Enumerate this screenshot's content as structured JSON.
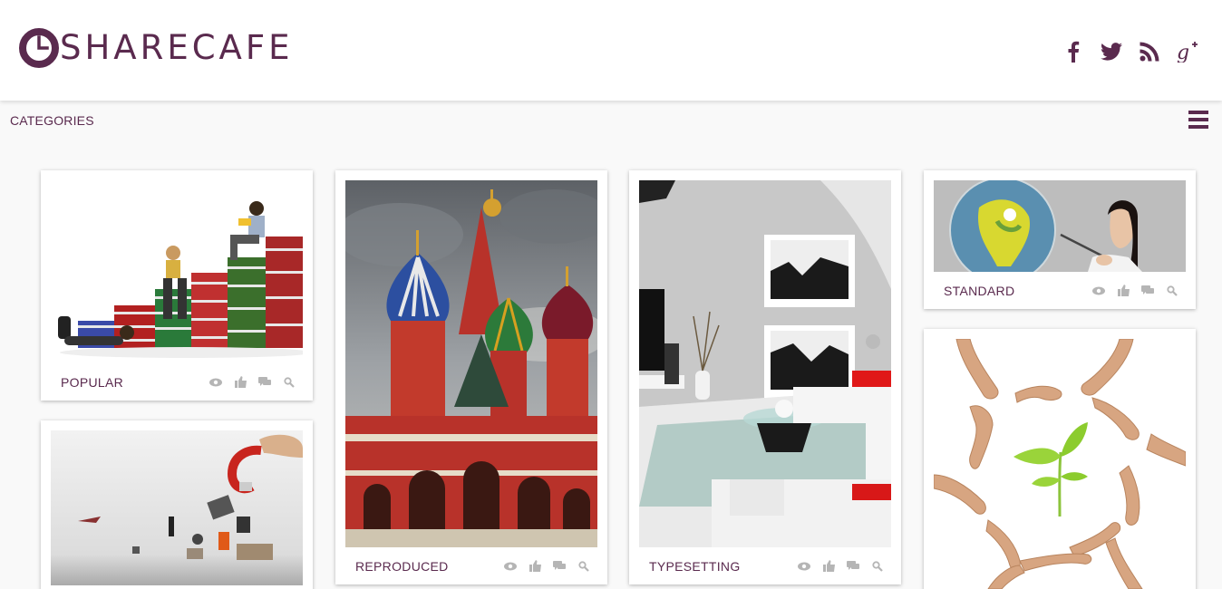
{
  "brand": {
    "name": "SHARECAFE",
    "color": "#5a2a4e"
  },
  "social": [
    {
      "name": "facebook-icon",
      "glyph": "f"
    },
    {
      "name": "twitter-icon",
      "glyph": ""
    },
    {
      "name": "rss-icon",
      "glyph": ""
    },
    {
      "name": "google-plus-icon",
      "glyph": "g+"
    }
  ],
  "nav": {
    "categories_label": "CATEGORIES"
  },
  "cards": [
    {
      "title": "POPULAR",
      "image": "students-on-books"
    },
    {
      "title": "REPRODUCED",
      "image": "st-basils-cathedral"
    },
    {
      "title": "TYPESETTING",
      "image": "modern-living-room"
    },
    {
      "title": "STANDARD",
      "image": "woman-with-globe"
    },
    {
      "title": "",
      "image": "magnet-attracting-people"
    },
    {
      "title": "",
      "image": "hands-around-sprout"
    }
  ],
  "card_actions": [
    "views-icon",
    "like-icon",
    "comments-icon",
    "zoom-icon"
  ]
}
